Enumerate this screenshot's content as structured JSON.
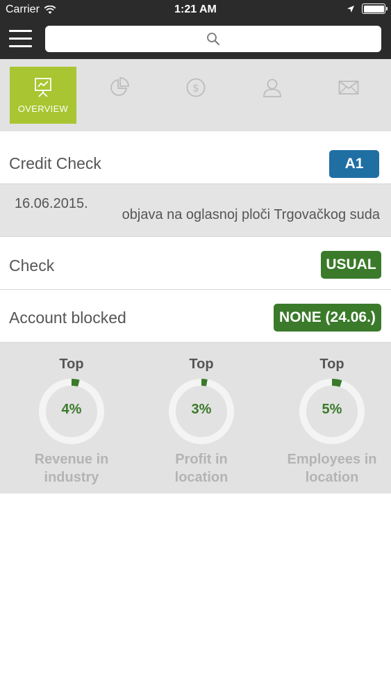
{
  "status_bar": {
    "carrier": "Carrier",
    "time": "1:21 AM"
  },
  "tabs": [
    {
      "label": "OVERVIEW",
      "icon": "presentation-chart-icon",
      "active": true
    },
    {
      "label": "",
      "icon": "pie-chart-icon"
    },
    {
      "label": "",
      "icon": "dollar-coin-icon"
    },
    {
      "label": "",
      "icon": "person-icon"
    },
    {
      "label": "",
      "icon": "envelope-icon"
    }
  ],
  "credit_check": {
    "label": "Credit Check",
    "badge": "A1",
    "badge_color": "#1f6fa3"
  },
  "notice": {
    "date": "16.06.2015.",
    "text": "objava na oglasnoj ploči Trgovačkog suda"
  },
  "check": {
    "label": "Check",
    "badge": "USUAL",
    "badge_color": "#3a7a2a"
  },
  "account_blocked": {
    "label": "Account blocked",
    "badge": "NONE (24.06.)",
    "badge_color": "#3a7a2a"
  },
  "stats": [
    {
      "top": "Top",
      "percent": "4%",
      "value": 4,
      "caption_line1": "Revenue in",
      "caption_line2": "industry"
    },
    {
      "top": "Top",
      "percent": "3%",
      "value": 3,
      "caption_line1": "Profit in",
      "caption_line2": "location"
    },
    {
      "top": "Top",
      "percent": "5%",
      "value": 5,
      "caption_line1": "Employees in",
      "caption_line2": "location"
    }
  ],
  "colors": {
    "accent": "#a9c531",
    "ring_fill": "#3a7a2a",
    "ring_track": "#f4f4f4"
  }
}
